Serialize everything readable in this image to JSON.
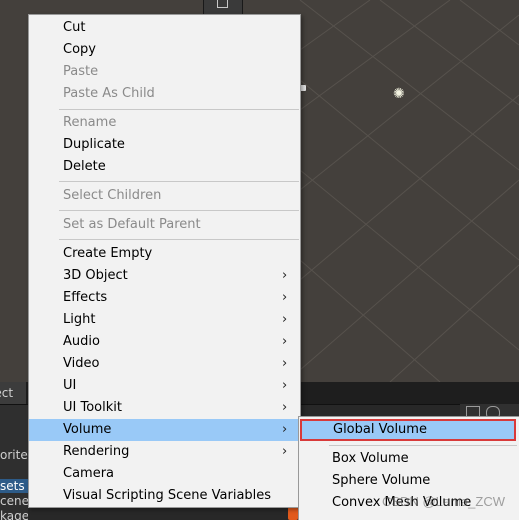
{
  "menu": {
    "items": [
      {
        "label": "Cut",
        "disabled": false
      },
      {
        "label": "Copy",
        "disabled": false
      },
      {
        "label": "Paste",
        "disabled": true
      },
      {
        "label": "Paste As Child",
        "disabled": true
      },
      {
        "label": "Rename",
        "disabled": true
      },
      {
        "label": "Duplicate",
        "disabled": false
      },
      {
        "label": "Delete",
        "disabled": false
      },
      {
        "label": "Select Children",
        "disabled": true
      },
      {
        "label": "Set as Default Parent",
        "disabled": true
      },
      {
        "label": "Create Empty",
        "disabled": false
      },
      {
        "label": "3D Object",
        "submenu": true
      },
      {
        "label": "Effects",
        "submenu": true
      },
      {
        "label": "Light",
        "submenu": true
      },
      {
        "label": "Audio",
        "submenu": true
      },
      {
        "label": "Video",
        "submenu": true
      },
      {
        "label": "UI",
        "submenu": true
      },
      {
        "label": "UI Toolkit",
        "submenu": true
      },
      {
        "label": "Volume",
        "submenu": true,
        "highlighted": true
      },
      {
        "label": "Rendering",
        "submenu": true
      },
      {
        "label": "Camera",
        "disabled": false
      },
      {
        "label": "Visual Scripting Scene Variables",
        "disabled": false
      }
    ],
    "arrow_glyph": "›"
  },
  "submenu": {
    "items": [
      {
        "label": "Global Volume",
        "highlighted": true
      },
      {
        "label": "Box Volume"
      },
      {
        "label": "Sphere Volume"
      },
      {
        "label": "Convex Mesh Volume"
      }
    ]
  },
  "bottom_panel": {
    "tab_label": "ject",
    "rows": [
      "orite",
      "sets",
      "cene",
      "kage"
    ]
  },
  "watermark": "CSDN @Lama_ZCW",
  "colors": {
    "menu_bg": "#f2f2f2",
    "highlight": "#99c9f7",
    "highlight_outline": "#d83a3a",
    "scene_bg": "#44403c"
  }
}
